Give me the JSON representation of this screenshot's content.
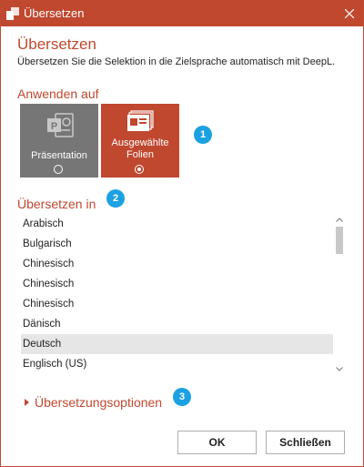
{
  "window": {
    "title": "Übersetzen"
  },
  "dialog": {
    "heading": "Übersetzen",
    "description": "Übersetzen Sie die Selektion in die Zielsprache automatisch mit DeepL."
  },
  "apply_section": {
    "label": "Anwenden auf",
    "options": [
      {
        "label": "Präsentation",
        "selected": false,
        "icon": "powerpoint-icon"
      },
      {
        "label_line1": "Ausgewählte",
        "label_line2": "Folien",
        "selected": true,
        "icon": "slides-icon"
      }
    ],
    "badge": "1"
  },
  "translate_section": {
    "label": "Übersetzen in",
    "badge": "2",
    "languages": [
      "Arabisch",
      "Bulgarisch",
      "Chinesisch",
      "Chinesisch",
      "Chinesisch",
      "Dänisch",
      "Deutsch",
      "Englisch (US)"
    ],
    "selected_language": "Deutsch"
  },
  "options_section": {
    "label": "Übersetzungsoptionen",
    "badge": "3"
  },
  "buttons": {
    "ok": "OK",
    "close": "Schließen"
  },
  "colors": {
    "accent": "#c0482f",
    "badge": "#1ba1e2",
    "tile_gray": "#767676"
  }
}
